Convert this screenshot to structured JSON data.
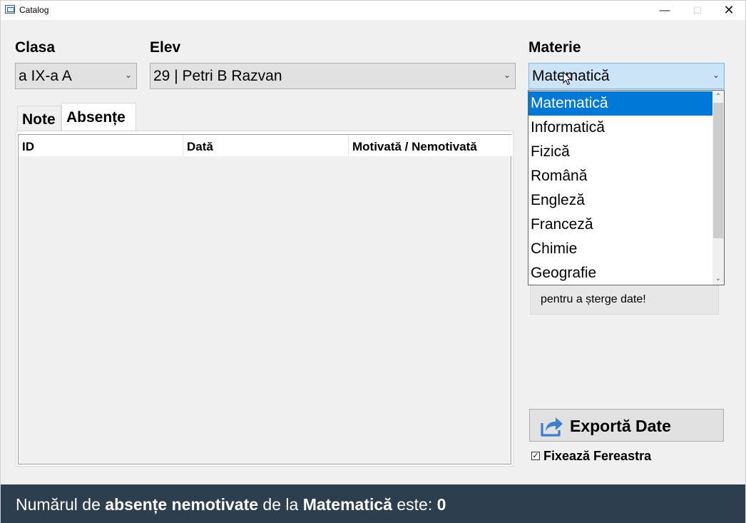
{
  "window": {
    "title": "Catalog",
    "min_label": "—",
    "max_label": "☐",
    "close_label": "✕"
  },
  "clasa": {
    "label": "Clasa",
    "value": "a IX-a A"
  },
  "elev": {
    "label": "Elev",
    "value": "29 | Petri B Razvan"
  },
  "materie": {
    "label": "Materie",
    "value": "Matematică",
    "options": [
      "Matematică",
      "Informatică",
      "Fizică",
      "Română",
      "Engleză",
      "Franceză",
      "Chimie",
      "Geografie"
    ]
  },
  "tabs": {
    "note": "Note",
    "absente": "Absențe"
  },
  "grid": {
    "columns": [
      "ID",
      "Dată",
      "Motivată / Nemotivată"
    ]
  },
  "info": {
    "text": "pentru a șterge date!"
  },
  "export": {
    "label": "Exportă Date"
  },
  "fix_window": {
    "label": "Fixează Fereastra",
    "checked": true,
    "check_glyph": "✓"
  },
  "status": {
    "part1": "Numărul de ",
    "bold1": "absențe nemotivate",
    "part2": " de la ",
    "bold2": "Matematică",
    "part3": " este: ",
    "count": "0"
  },
  "colors": {
    "status_bg": "#2d3e4e",
    "selected_bg": "#0078d7",
    "combo_open_bg": "#cce4f7"
  }
}
